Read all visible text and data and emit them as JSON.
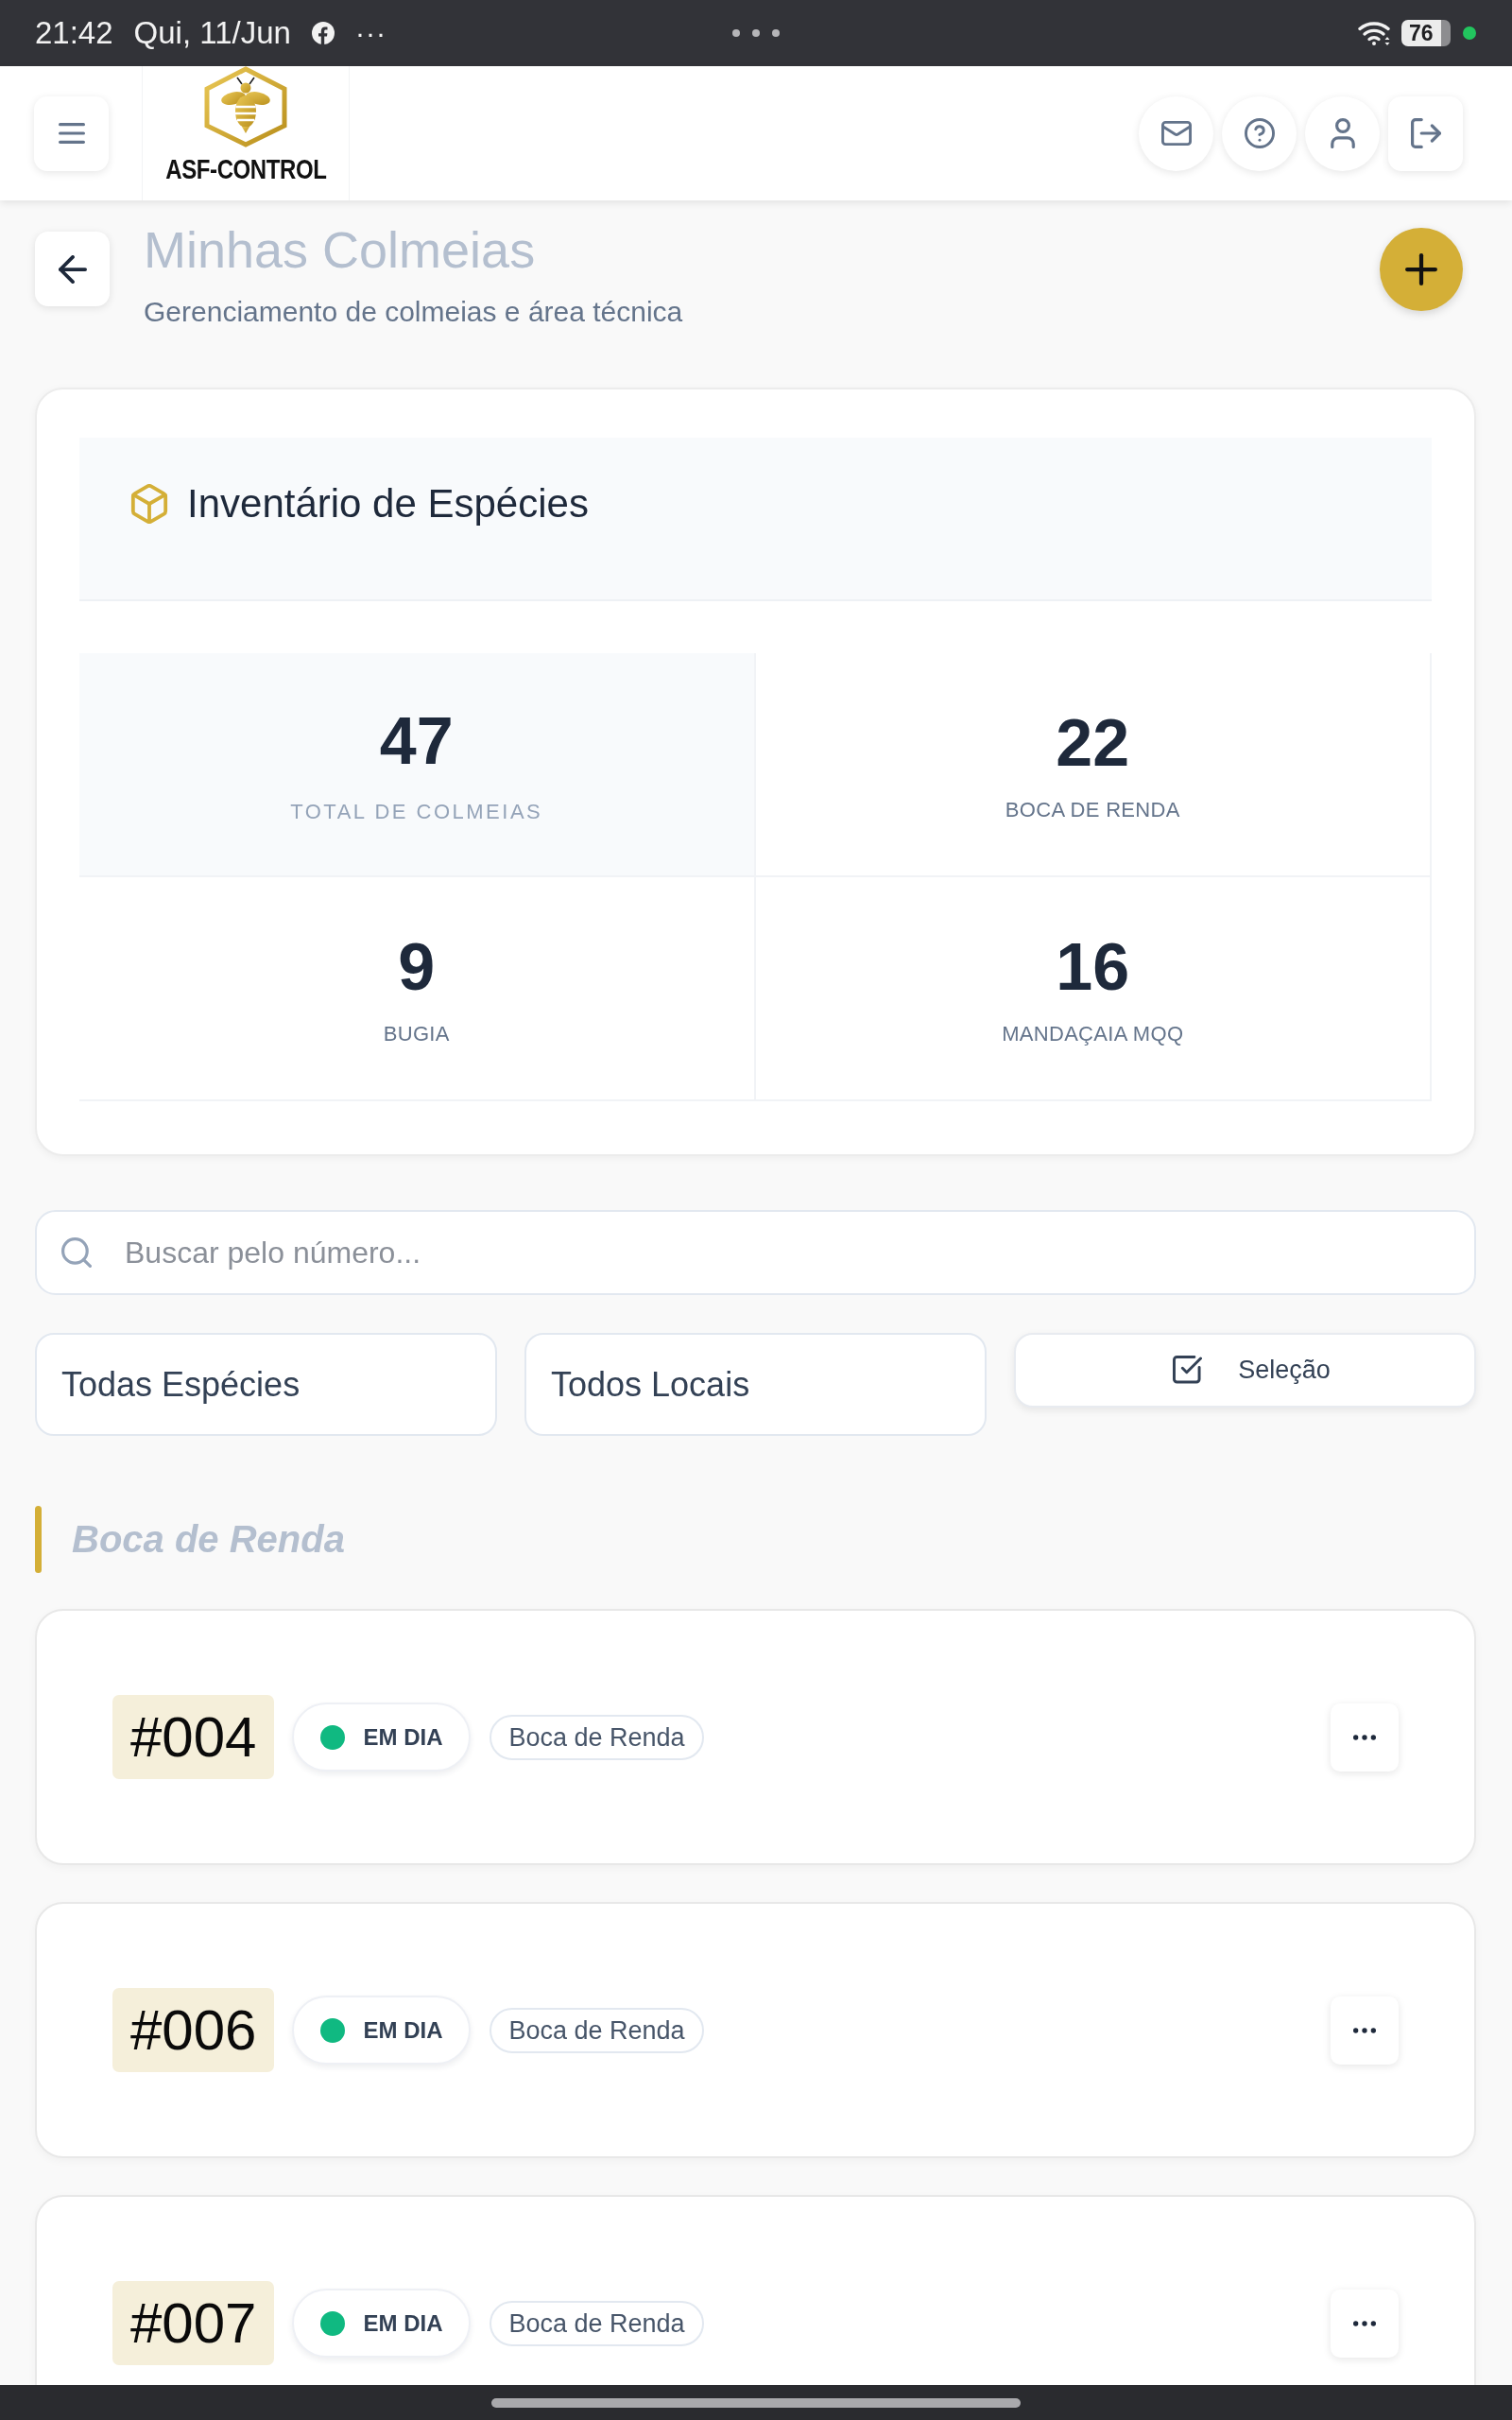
{
  "status_bar": {
    "time": "21:42",
    "date": "Qui, 11/Jun",
    "overflow": "···",
    "battery": "76"
  },
  "header": {
    "logo_text": "ASF-CONTROL"
  },
  "page": {
    "title": "Minhas Colmeias",
    "subtitle": "Gerenciamento de colmeias e área técnica"
  },
  "inventory": {
    "title": "Inventário de Espécies",
    "stats": [
      {
        "kind": "total",
        "value": "47",
        "label": "TOTAL DE COLMEIAS"
      },
      {
        "kind": "species",
        "value": "22",
        "label": "BOCA DE RENDA"
      },
      {
        "kind": "species",
        "value": "9",
        "label": "BUGIA"
      },
      {
        "kind": "species",
        "value": "16",
        "label": "MANDAÇAIA MQQ"
      }
    ]
  },
  "search": {
    "placeholder": "Buscar pelo número..."
  },
  "filters": [
    {
      "kind": "select",
      "value": "Todas Espécies"
    },
    {
      "kind": "select",
      "value": "Todos Locais"
    },
    {
      "kind": "toggle",
      "label": "Seleção"
    }
  ],
  "sections": [
    {
      "title": "Boca de Renda",
      "hives": [
        {
          "number": "#004",
          "status": {
            "label": "EM DIA",
            "color": "#10b981"
          },
          "species": "Boca de Renda"
        },
        {
          "number": "#006",
          "status": {
            "label": "EM DIA",
            "color": "#10b981"
          },
          "species": "Boca de Renda"
        },
        {
          "number": "#007",
          "status": {
            "label": "EM DIA",
            "color": "#10b981"
          },
          "species": "Boca de Renda"
        }
      ]
    }
  ]
}
